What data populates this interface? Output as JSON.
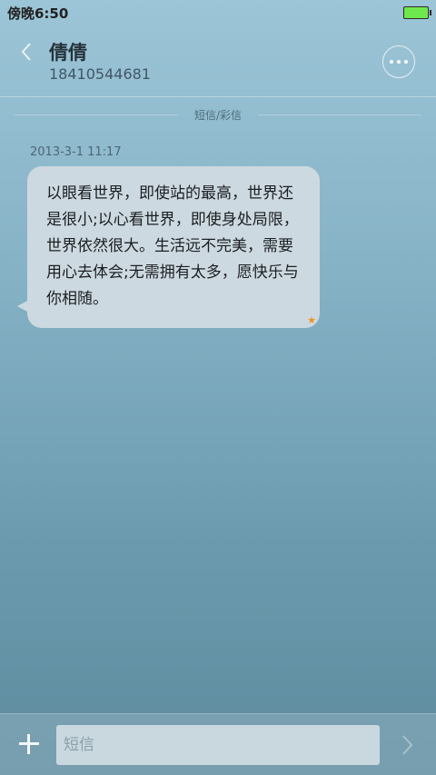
{
  "status_bar": {
    "time": "傍晚6:50",
    "battery_color": "#6fe84d"
  },
  "header": {
    "back_icon": "chevron-left-icon",
    "contact_name": "倩倩",
    "contact_number": "18410544681",
    "more_icon": "more-dots-icon"
  },
  "conversation": {
    "message_type_label": "短信/彩信",
    "messages": [
      {
        "timestamp": "2013-3-1 11:17",
        "text": "以眼看世界，即使站的最高，世界还是很小;以心看世界，即使身处局限，世界依然很大。生活远不完美，需要用心去体会;无需拥有太多，愿快乐与你相随。",
        "star_icon": "star-icon",
        "star_color": "#f0931c"
      }
    ]
  },
  "composer": {
    "add_icon": "plus-icon",
    "input_value": "",
    "input_placeholder": "短信",
    "send_icon": "chevron-right-icon"
  }
}
